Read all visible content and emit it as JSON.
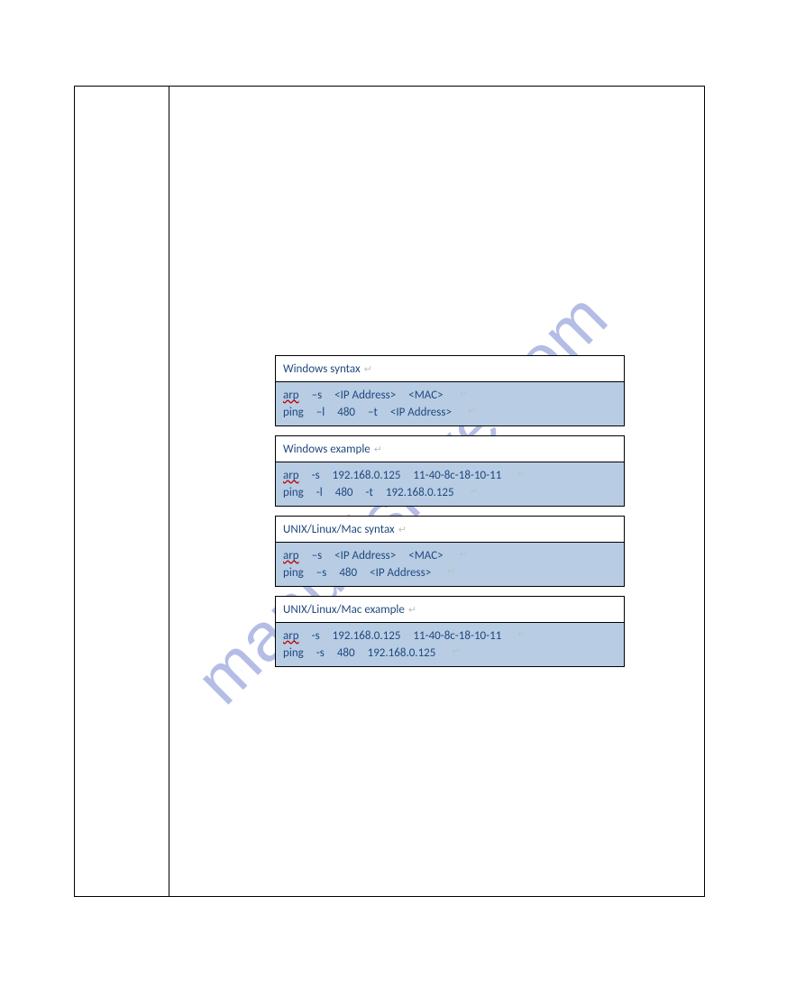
{
  "watermark": "manualshive.com",
  "sections": [
    {
      "title": "Windows syntax",
      "line1": {
        "c1": "arp",
        "c2": "–s",
        "c3": "<IP Address>",
        "c4": "<MAC>",
        "p": "↵"
      },
      "line2": {
        "c1": "ping",
        "c2": "–l",
        "c3": "480",
        "c4": "–t",
        "c5": "<IP Address>",
        "p": "↵"
      }
    },
    {
      "title": "Windows example",
      "line1": {
        "c1": "arp",
        "c2": "-s",
        "c3": "192.168.0.125",
        "c4": "11-40-8c-18-10-11",
        "p": "↵"
      },
      "line2": {
        "c1": "ping",
        "c2": "-l",
        "c3": "480",
        "c4": "-t",
        "c5": "192.168.0.125",
        "p": "↵"
      }
    },
    {
      "title": "UNIX/Linux/Mac syntax",
      "line1": {
        "c1": "arp",
        "c2": "–s",
        "c3": "<IP Address>",
        "c4": "<MAC>",
        "p": "↵"
      },
      "line2": {
        "c1": "ping",
        "c2": "–s",
        "c3": "480",
        "c4": "<IP Address>",
        "p": "↵"
      }
    },
    {
      "title": "UNIX/Linux/Mac example",
      "line1": {
        "c1": "arp",
        "c2": "-s",
        "c3": "192.168.0.125",
        "c4": "11-40-8c-18-10-11",
        "p": "↵"
      },
      "line2": {
        "c1": "ping",
        "c2": "-s",
        "c3": "480",
        "c4": "192.168.0.125",
        "p": "↵"
      }
    }
  ]
}
